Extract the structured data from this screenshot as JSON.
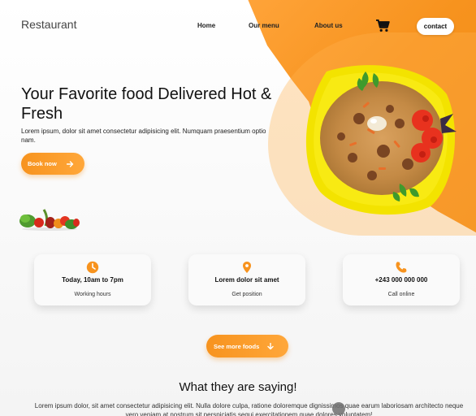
{
  "header": {
    "brand": "Restaurant",
    "nav": [
      "Home",
      "Our menu",
      "About us"
    ],
    "contact": "contact",
    "cart_icon": "cart-icon"
  },
  "hero": {
    "title": "Your Favorite food Delivered Hot & Fresh",
    "text": "Lorem ipsum, dolor sit amet consectetur adipisicing elit. Numquam praesentium optio nam.",
    "button": "Book now",
    "button_icon": "arrow-right-icon"
  },
  "cards": [
    {
      "icon": "clock-icon",
      "title": "Today, 10am to 7pm",
      "subtitle": "Working hours"
    },
    {
      "icon": "map-pin-icon",
      "title": "Lorem dolor sit amet",
      "subtitle": "Get position"
    },
    {
      "icon": "phone-icon",
      "title": "+243 000 000 000",
      "subtitle": "Call online"
    }
  ],
  "more": {
    "button": "See more foods",
    "button_icon": "arrow-down-icon"
  },
  "testimonials": {
    "title": "What they are saying!",
    "text": "Lorem ipsum dolor, sit amet consectetur adipisicing elit. Nulla dolore culpa, ratione doloremque dignissimos quae earum laboriosam architecto neque vero veniam at nostrum sit perspiciatis sequi exercitationem quae dolores voluptatem!"
  },
  "colors": {
    "accent": "#f7931e",
    "plate": "#f5e400"
  }
}
